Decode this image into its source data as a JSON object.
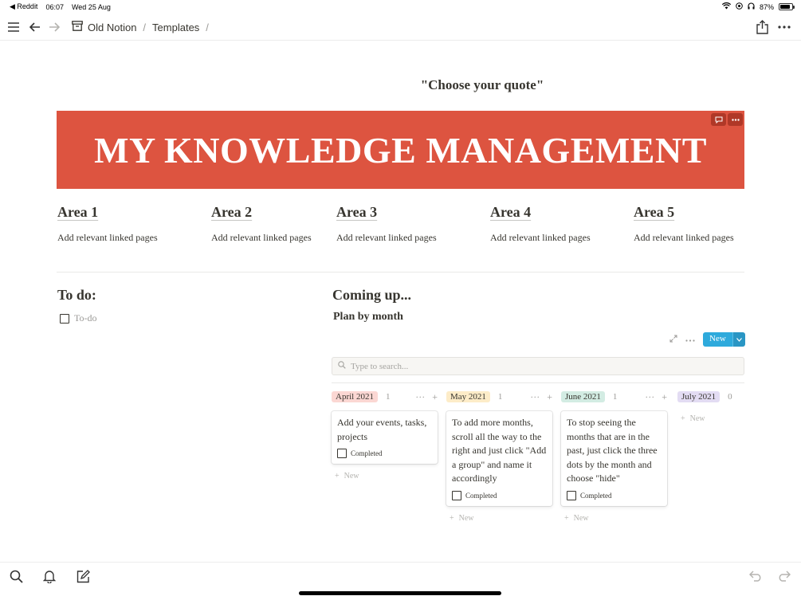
{
  "status_bar": {
    "back_app": "◀ Reddit",
    "time": "06:07",
    "date": "Wed 25 Aug",
    "battery": "87%",
    "battery_level": 0.87
  },
  "nav": {
    "icons": [
      "menu-icon",
      "back-arrow-icon",
      "forward-arrow-icon",
      "archive-icon",
      "share-icon",
      "more-icon"
    ],
    "breadcrumb": [
      "Old Notion",
      "Templates"
    ],
    "separator": "/"
  },
  "page": {
    "quote": "\"Choose your quote\"",
    "banner_title": "MY KNOWLEDGE MANAGEMENT",
    "banner_tools": [
      "comment-icon",
      "more-icon"
    ],
    "areas": [
      {
        "title": "Area 1",
        "desc": "Add relevant linked pages"
      },
      {
        "title": "Area 2",
        "desc": "Add relevant linked pages"
      },
      {
        "title": "Area 3",
        "desc": "Add relevant linked pages"
      },
      {
        "title": "Area 4",
        "desc": "Add relevant linked pages"
      },
      {
        "title": "Area 5",
        "desc": "Add relevant linked pages"
      }
    ],
    "todo": {
      "title": "To do:",
      "item_placeholder": "To-do"
    },
    "coming_up": {
      "title": "Coming up...",
      "subtitle": "Plan by month"
    }
  },
  "board": {
    "new_label": "New",
    "search_placeholder": "Type to search...",
    "add_label": "New",
    "columns": [
      {
        "name": "April 2021",
        "count": "1",
        "color": "#fbd7d3",
        "card": {
          "text": "Add your events, tasks, projects",
          "prop_label": "Completed"
        }
      },
      {
        "name": "May 2021",
        "count": "1",
        "color": "#fdecc8",
        "card": {
          "text": "To add more months, scroll all the way to the right and just click \"Add a group\" and name it accordingly",
          "prop_label": "Completed"
        }
      },
      {
        "name": "June 2021",
        "count": "1",
        "color": "#d3ece3",
        "card": {
          "text": "To stop seeing the months that are in the past, just click the three dots by the month and choose \"hide\"",
          "prop_label": "Completed"
        }
      },
      {
        "name": "July 2021",
        "count": "0",
        "color": "#e3dcf3",
        "card": null
      }
    ]
  },
  "bottom_bar": {
    "icons": [
      "search-icon",
      "bell-icon",
      "compose-icon",
      "undo-icon",
      "redo-icon"
    ]
  }
}
